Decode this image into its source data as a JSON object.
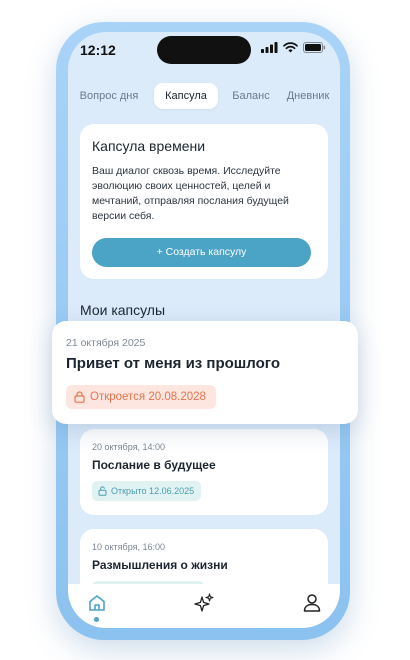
{
  "status_bar": {
    "time": "12:12"
  },
  "tabs": [
    {
      "label": "Вопрос дня",
      "active": false
    },
    {
      "label": "Капсула",
      "active": true
    },
    {
      "label": "Баланс",
      "active": false
    },
    {
      "label": "Дневник",
      "active": false
    }
  ],
  "intro": {
    "title": "Капсула времени",
    "text": "Ваш диалог сквозь время. Исследуйте эволюцию своих ценностей, целей и мечтаний, отправляя послания будущей версии себя.",
    "button_label": "+ Создать капсулу"
  },
  "section_title": "Мои капсулы",
  "featured_capsule": {
    "date": "21 октября 2025",
    "title": "Привет от меня из прошлого",
    "badge": "Откроется 20.08.2028"
  },
  "capsules": [
    {
      "date": "20 октября, 14:00",
      "title": "Послание в будущее",
      "badge": "Открыто 12.06.2025"
    },
    {
      "date": "10 октября, 16:00",
      "title": "Размышления о жизни",
      "badge": ""
    }
  ],
  "nav": {
    "items": [
      {
        "icon": "home-icon",
        "active": true
      },
      {
        "icon": "sparkles-icon",
        "active": false
      },
      {
        "icon": "profile-icon",
        "active": false
      }
    ]
  },
  "colors": {
    "accent": "#4ba4c6",
    "screen_bg": "#dcebfa",
    "frame": "#a9d3f7",
    "locked_badge_bg": "#fde6df",
    "locked_badge_text": "#e6744f",
    "open_badge_bg": "#e1f2f3",
    "open_badge_text": "#4a9db0"
  }
}
